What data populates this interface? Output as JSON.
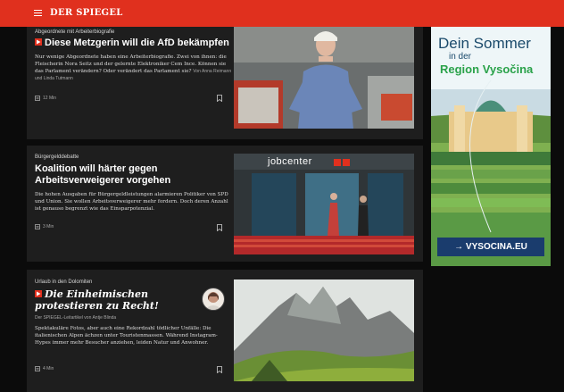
{
  "header": {
    "logo": "DER SPIEGEL",
    "brand_color": "#e0301e"
  },
  "articles": [
    {
      "kicker": "Abgeordnete mit Arbeiterbiografie",
      "headline": "Diese Metzgerin will die AfD bekämpfen",
      "badge_icon": "spiegel-plus-icon",
      "teaser": "Nur wenige Abgeordnete haben eine Arbeiterbiografie. Zwei von ihnen: die Fleischerin Nora Seitz und der gelernte Elektroniker Cem Ince. Können sie das Parlament verändern? Oder verändert das Parlament sie?",
      "author": "Von Anna Reimann und Linda Tutmann",
      "read_time": "12 Min"
    },
    {
      "kicker": "Bürgergelddebatte",
      "headline": "Koalition will härter gegen Arbeitsverweigerer vorgehen",
      "teaser": "Die hohen Ausgaben für Bürgergeldleistungen alarmieren Politiker von SPD und Union. Sie wollen Arbeitsverweigerer mehr fordern. Doch deren Anzahl ist genauso begrenzt wie das Einsparpotenzial.",
      "read_time": "3 Min",
      "image_text": "jobcenter"
    },
    {
      "kicker": "Urlaub in den Dolomiten",
      "headline": "Die Einheimischen protestieren zu Recht!",
      "badge_icon": "spiegel-plus-icon",
      "byline": "Der SPIEGEL-Leitartikel von Antje Blinda",
      "teaser": "Spektakuläre Fotos, aber auch eine Rekordzahl tödlicher Unfälle: Die italienischen Alpen ächzen unter Touristenmassen. Während Instagram-Hypes immer mehr Besucher anziehen, leiden Natur und Anwohner.",
      "read_time": "4 Min"
    }
  ],
  "ad": {
    "line1": "Dein Sommer",
    "line2": "in der",
    "line3_prefix": "Region",
    "line3_highlight": "Vysočina",
    "cta": "→ VYSOCINA.EU"
  }
}
